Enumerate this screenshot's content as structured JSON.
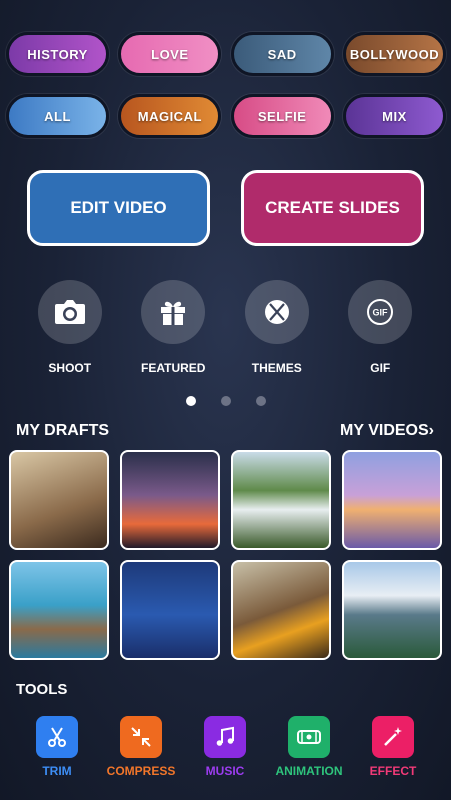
{
  "categories": {
    "row1": [
      {
        "label": "HISTORY",
        "bg": "linear-gradient(90deg,#7c3aa8,#b154c9)"
      },
      {
        "label": "LOVE",
        "bg": "linear-gradient(90deg,#e66ab1,#f08fc4)"
      },
      {
        "label": "SAD",
        "bg": "linear-gradient(90deg,#3b5b7a,#5f86a8)"
      },
      {
        "label": "BOLLYWOOD",
        "bg": "linear-gradient(90deg,#7a4a2c,#b57446)"
      }
    ],
    "row2": [
      {
        "label": "ALL",
        "bg": "linear-gradient(90deg,#3d7ac4,#7ab3e8)"
      },
      {
        "label": "MAGICAL",
        "bg": "linear-gradient(90deg,#b8561f,#e08a34)"
      },
      {
        "label": "SELFIE",
        "bg": "linear-gradient(90deg,#d74c86,#f08ab8)"
      },
      {
        "label": "MIX",
        "bg": "linear-gradient(90deg,#5b3496,#8e5ad0)"
      }
    ]
  },
  "actions": {
    "edit_video": "EDIT VIDEO",
    "create_slides": "CREATE SLIDES"
  },
  "quick": [
    {
      "label": "SHOOT",
      "icon": "camera-icon"
    },
    {
      "label": "FEATURED",
      "icon": "gift-icon"
    },
    {
      "label": "THEMES",
      "icon": "themes-icon"
    },
    {
      "label": "GIF",
      "icon": "gif-icon"
    }
  ],
  "pager": {
    "count": 3,
    "active": 0
  },
  "sections": {
    "drafts": "MY DRAFTS",
    "videos": "MY VIDEOS",
    "videos_chevron": "›"
  },
  "thumbnails": [
    {
      "name": "couple-photo",
      "bg": "linear-gradient(160deg,#d9c7a5,#8a6a4a 60%,#3b2a1e)"
    },
    {
      "name": "hearts-photo",
      "bg": "linear-gradient(180deg,#2a2f4a,#7a5a8a 45%,#e86a3a 75%,#201a2a)"
    },
    {
      "name": "waterfall-photo",
      "bg": "linear-gradient(180deg,#c9dbe8,#5f8a4a 40%,#e8eef0 60%,#3a5a2a)"
    },
    {
      "name": "sunset-photo",
      "bg": "linear-gradient(180deg,#8fa0e0,#c8a0d8 45%,#f0b070 60%,#6a5aa8)"
    },
    {
      "name": "pier-photo",
      "bg": "linear-gradient(180deg,#7ec4e8,#3aa0c8 45%,#8a6a4a 70%,#2a7aa0)"
    },
    {
      "name": "swan-photo",
      "bg": "linear-gradient(180deg,#1e3a7a,#2a5ab0 55%,#1a2e6a)"
    },
    {
      "name": "eagle-photo",
      "bg": "linear-gradient(160deg,#c8c0a8,#7a5a3a 50%,#e8a020 70%,#3a2a1a)"
    },
    {
      "name": "mountain-photo",
      "bg": "linear-gradient(180deg,#a8c8e8,#e8eef4 35%,#5a7a8a 55%,#2a5a3a)"
    }
  ],
  "tools_title": "TOOLS",
  "tools": [
    {
      "label": "TRIM",
      "color": "#2f7ff0",
      "text": "#3d8ef5",
      "icon": "scissors-icon"
    },
    {
      "label": "COMPRESS",
      "color": "#ef6a1f",
      "text": "#f2762a",
      "icon": "compress-icon"
    },
    {
      "label": "MUSIC",
      "color": "#8a2be2",
      "text": "#9c3cf0",
      "icon": "music-icon"
    },
    {
      "label": "ANIMATION",
      "color": "#1fb06a",
      "text": "#2ec47c",
      "icon": "film-icon"
    },
    {
      "label": "EFFECT",
      "color": "#ec1f66",
      "text": "#f23a78",
      "icon": "magic-wand-icon"
    }
  ]
}
